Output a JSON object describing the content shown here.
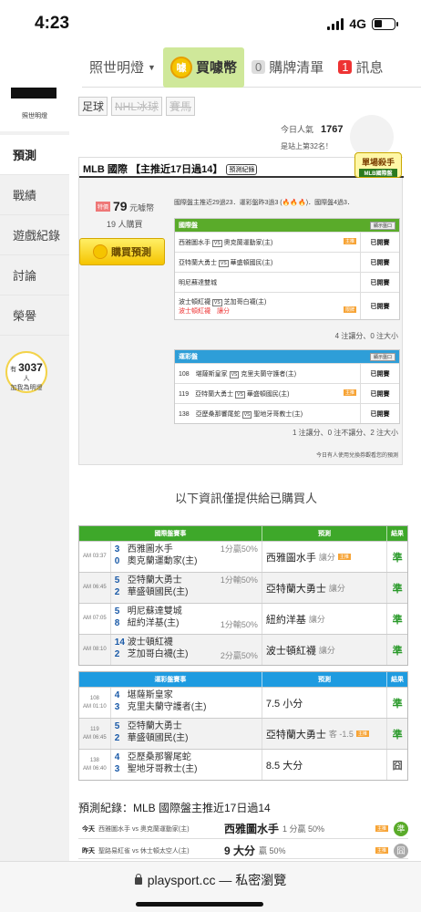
{
  "status": {
    "time": "4:23",
    "network": "4G"
  },
  "topnav": {
    "lamp": "照世明燈",
    "buy": "買噱幣",
    "cart_count": "0",
    "cart": "購牌清單",
    "msg_count": "1",
    "msg": "訊息"
  },
  "sidebar": {
    "logo_label": "照世明燈",
    "items": [
      "預測",
      "戰績",
      "遊戲紀錄",
      "討論",
      "榮譽"
    ],
    "fans_prefix": "有",
    "fans": "3037",
    "fans_suffix": "人",
    "fans_action": "加我為明燈"
  },
  "sports": [
    "足球",
    "NHL冰球",
    "賽馬"
  ],
  "popularity": {
    "label": "今日人氣",
    "value": "1767",
    "rank": "是站上第32名！"
  },
  "card": {
    "title": "MLB 國際 【主推近17日過14】",
    "record_tag": "預測紀錄",
    "badge": "單場殺手",
    "badge_sub": "MLB國際盤",
    "price_unit": "元噱幣",
    "price": "79",
    "buyers": "19 人購買",
    "buy_button": "購買預測",
    "summary": "國際盤主推近29過23．運彩盤昨3過3 (🔥🔥🔥)．國際盤4過3．",
    "intl": {
      "header": "國際盤",
      "btn": "顯示盤口",
      "rows": [
        {
          "away": "西雅圖水手",
          "home": "奧克蘭運動家(主)",
          "flag": "主推",
          "result": "已開賽",
          "note": ""
        },
        {
          "away": "亞特蘭大勇士",
          "home": "華盛頓國民(主)",
          "flag": "",
          "result": "已開賽",
          "note": ""
        },
        {
          "away": "明尼蘇達雙城",
          "home": "",
          "flag": "",
          "result": "已開賽",
          "note": ""
        },
        {
          "away": "波士頓紅襪",
          "home": "芝加哥白襪(主)",
          "flag": "限牌",
          "result": "已開賽",
          "note": "波士頓紅襪　讓分"
        }
      ],
      "foot": "4 注讓分、0 注大小"
    },
    "sport": {
      "header": "運彩盤",
      "btn": "顯示盤口",
      "rows": [
        {
          "no": "108",
          "away": "堪薩斯皇家",
          "home": "克里夫蘭守護者(主)",
          "flag": "",
          "result": "已開賽"
        },
        {
          "no": "119",
          "away": "亞特蘭大勇士",
          "home": "華盛頓國民(主)",
          "flag": "主推",
          "result": "已開賽"
        },
        {
          "no": "138",
          "away": "亞歷桑那響尾蛇",
          "home": "聖地牙哥教士(主)",
          "flag": "",
          "result": "已開賽"
        }
      ],
      "foot": "1 注讓分、0 注不讓分、2 注大小"
    },
    "footnote": "今日有人使用兌換券觀看您的預測"
  },
  "info_note": "以下資訊僅提供給已購買人",
  "intl_results": {
    "h1": "國際盤賽事",
    "h2": "預測",
    "h3": "結果",
    "rows": [
      {
        "time": "AM 03:37",
        "s1": "3",
        "t1": "西雅圖水手",
        "s2": "0",
        "t2": "奧克蘭運動家(主)",
        "line": "1分贏50%",
        "pick": "西雅圖水手",
        "type": "讓分",
        "flag": "主推",
        "res": "準"
      },
      {
        "time": "AM 06:45",
        "s1": "5",
        "t1": "亞特蘭大勇士",
        "s2": "2",
        "t2": "華盛頓國民(主)",
        "line": "1分輸50%",
        "pick": "亞特蘭大勇士",
        "type": "讓分",
        "flag": "",
        "res": "準"
      },
      {
        "time": "AM 07:05",
        "s1": "5",
        "t1": "明尼蘇達雙城",
        "s2": "8",
        "t2": "紐約洋基(主)",
        "line": "1分輸50%",
        "pick": "紐約洋基",
        "type": "讓分",
        "flag": "",
        "res": "準"
      },
      {
        "time": "AM 08:10",
        "s1": "14",
        "t1": "波士頓紅襪",
        "s2": "2",
        "t2": "芝加哥白襪(主)",
        "line": "2分贏50%",
        "pick": "波士頓紅襪",
        "type": "讓分",
        "flag": "",
        "res": "準"
      }
    ]
  },
  "sport_results": {
    "h1": "運彩盤賽事",
    "h2": "預測",
    "h3": "結果",
    "rows": [
      {
        "time": "108\nAM 01:10",
        "s1": "4",
        "t1": "堪薩斯皇家",
        "s2": "3",
        "t2": "克里夫蘭守護者(主)",
        "line": "",
        "pick": "7.5 小分",
        "type": "",
        "flag": "",
        "res": "準"
      },
      {
        "time": "119\nAM 06:45",
        "s1": "5",
        "t1": "亞特蘭大勇士",
        "s2": "2",
        "t2": "華盛頓國民(主)",
        "line": "",
        "pick": "亞特蘭大勇士",
        "type": "客 -1.5",
        "flag": "主推",
        "res": "準"
      },
      {
        "time": "138\nAM 06:40",
        "s1": "4",
        "t1": "亞歷桑那響尾蛇",
        "s2": "3",
        "t2": "聖地牙哥教士(主)",
        "line": "",
        "pick": "8.5 大分",
        "type": "",
        "flag": "",
        "res": "囧"
      }
    ]
  },
  "record": {
    "title": "預測紀錄：MLB 國際盤主推近17日過14",
    "rows": [
      {
        "day": "今天",
        "match": "西雅圖水手 vs 奧克蘭運動家(主)",
        "pick": "西雅圖水手",
        "sub": "1 分贏 50%",
        "flag": "主推",
        "res": "準"
      },
      {
        "day": "昨天",
        "match": "聖路易紅雀 vs 休士頓太空人(主)",
        "pick": "9 大分",
        "sub": "贏 50%",
        "flag": "主推",
        "res": "囧"
      }
    ]
  },
  "browser": {
    "url": "playsport.cc",
    "mode": "— 私密瀏覽"
  }
}
